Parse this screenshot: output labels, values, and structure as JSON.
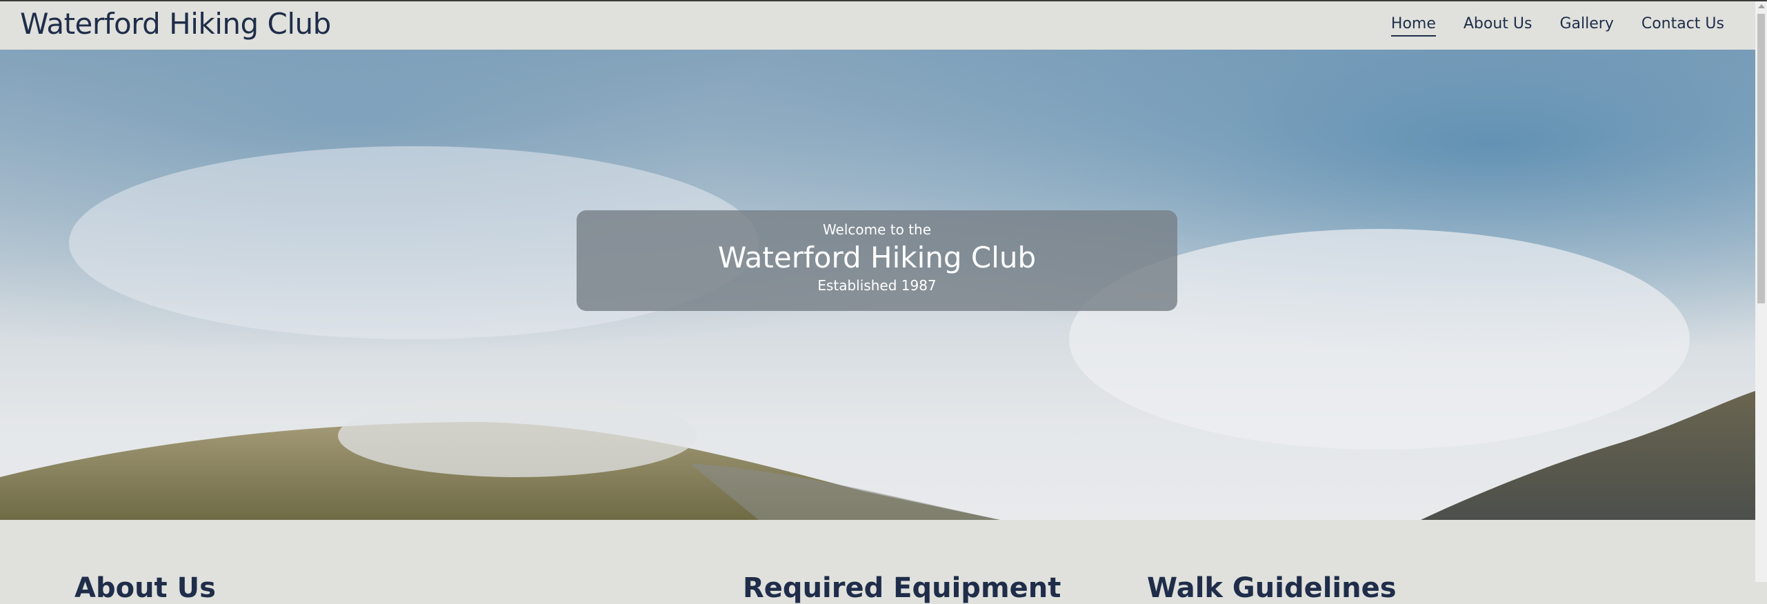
{
  "header": {
    "brand": "Waterford Hiking Club",
    "nav": [
      {
        "label": "Home",
        "active": true
      },
      {
        "label": "About Us"
      },
      {
        "label": "Gallery"
      },
      {
        "label": "Contact Us"
      }
    ]
  },
  "hero": {
    "subtitle": "Welcome to the",
    "title": "Waterford Hiking Club",
    "established": "Established 1987"
  },
  "sections": [
    {
      "title": "About Us"
    },
    {
      "title": "Required Equipment"
    },
    {
      "title": "Walk Guidelines"
    }
  ],
  "colors": {
    "primary": "#1f2d4a",
    "background": "#e0e1dc"
  }
}
